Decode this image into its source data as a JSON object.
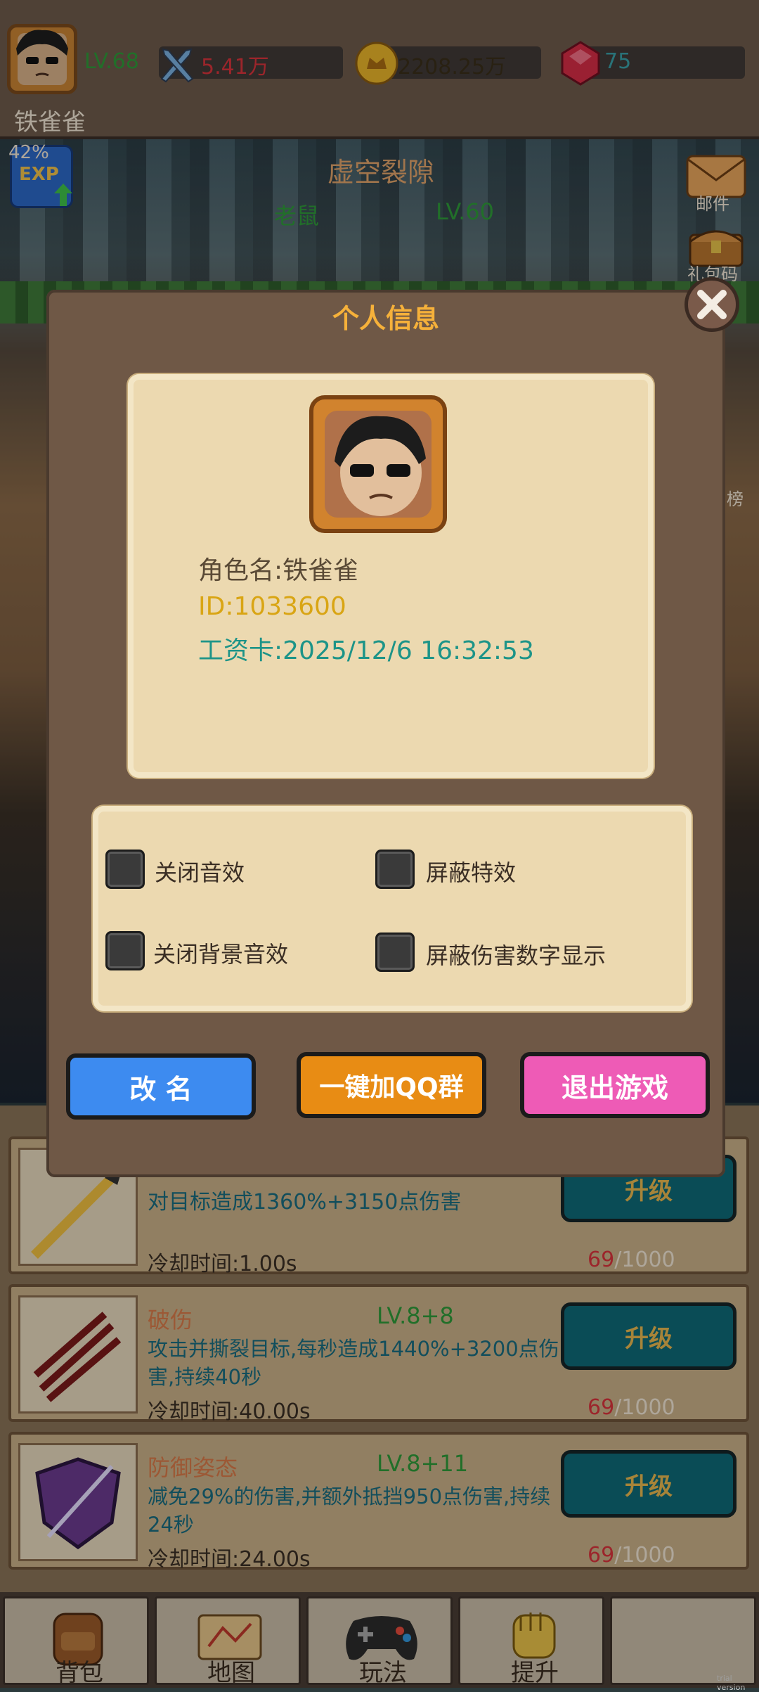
{
  "player": {
    "name": "铁雀雀",
    "level": "LV.68",
    "exp_percent": "42%",
    "exp_badge": "EXP"
  },
  "resources": {
    "attack": "5.41万",
    "gold": "2208.25万",
    "gems": "75"
  },
  "stage": {
    "name": "虚空裂隙",
    "enemy": "老鼠",
    "enemy_level": "LV.60"
  },
  "side_buttons": {
    "mail": "邮件",
    "gift_code": "礼包码",
    "rank_partial": "榜"
  },
  "modal": {
    "title": "个人信息",
    "role_name": "角色名:铁雀雀",
    "id": "ID:1033600",
    "salary_card": "工资卡:2025/12/6 16:32:53",
    "options": [
      {
        "label": "关闭音效",
        "checked": false
      },
      {
        "label": "屏蔽特效",
        "checked": false
      },
      {
        "label": "关闭背景音效",
        "checked": false
      },
      {
        "label": "屏蔽伤害数字显示",
        "checked": false
      }
    ],
    "buttons": {
      "rename": "改 名",
      "join_qq": "一键加QQ群",
      "exit": "退出游戏"
    }
  },
  "skills": [
    {
      "name": "",
      "level": "",
      "desc": "对目标造成1360%+3150点伤害",
      "cooldown": "冷却时间:1.00s",
      "cost_current": "69",
      "cost_total": "/1000",
      "upgrade": "升级"
    },
    {
      "name": "破伤",
      "level": "LV.8+8",
      "desc": "攻击并撕裂目标,每秒造成1440%+3200点伤害,持续40秒",
      "cooldown": "冷却时间:40.00s",
      "cost_current": "69",
      "cost_total": "/1000",
      "upgrade": "升级"
    },
    {
      "name": "防御姿态",
      "level": "LV.8+11",
      "desc": "减免29%的伤害,并额外抵挡950点伤害,持续24秒",
      "cooldown": "冷却时间:24.00s",
      "cost_current": "69",
      "cost_total": "/1000",
      "upgrade": "升级"
    }
  ],
  "bottom_nav": [
    "背包",
    "地图",
    "玩法",
    "提升"
  ],
  "watermark": "trial version",
  "colors": {
    "level_green": "#2f9a3a",
    "attack_red": "#d8343c",
    "gold_yellow": "#e0b23a",
    "gem_teal": "#3aa0a8",
    "title_orange": "#f6b13a",
    "id_yellow": "#d9a514",
    "salary_teal": "#1d9488",
    "rename_blue": "#3d8bf0",
    "qq_orange": "#e88c14",
    "exit_pink": "#ee5bb6"
  }
}
